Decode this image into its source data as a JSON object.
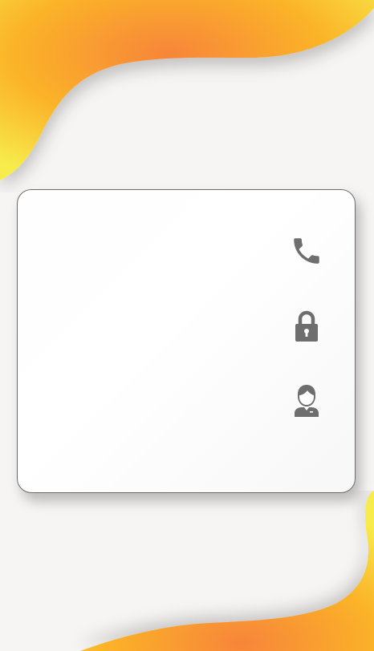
{
  "screen": {
    "background": "#f6f5f4",
    "accent_gradient": [
      "#f7e94a",
      "#fbb328",
      "#f7853a"
    ]
  },
  "form": {
    "fields": [
      {
        "name": "phone",
        "value": "",
        "placeholder": "",
        "icon": "phone-icon"
      },
      {
        "name": "password",
        "value": "",
        "placeholder": "",
        "icon": "lock-icon"
      },
      {
        "name": "user",
        "value": "",
        "placeholder": "",
        "icon": "user-icon"
      }
    ],
    "icon_color": "#6e6e6e"
  }
}
